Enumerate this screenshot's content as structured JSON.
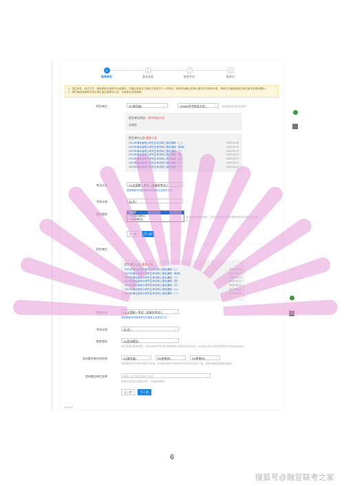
{
  "steps": [
    "报考单位",
    "基本信息",
    "报考专业",
    "报考点"
  ],
  "notice": {
    "line1": "1、招生单位、考试方式、报考类别与报考专业链接处，须通过查阅且了解后才能进行下一步报名，网报时间截止前请以报名时可修改为准，请考生仔细阅读招生单位和专业具体要求。",
    "line2": "2、请仔细阅读报考的招生单位招生简章及公告，以免报名信息错误。"
  },
  "form1": {
    "unit_label": "招生单位",
    "unit_province": "42(湖北省)",
    "unit_school": "10486(华中科技大学)",
    "unit_hint": "请查看该单位招生简章",
    "info_unit_label": "招生单位网站",
    "info_unit_link": "华中科技大学",
    "info_unit_addr": "无地址",
    "notice_title": "招生单位公告",
    "notice_more": "更多公告",
    "links": [
      {
        "text": "2021年湖北省硕士研究生考试网上报名通知（二）",
        "date": "2020.09.18"
      },
      {
        "text": "2021年湖北省硕士研究生考试网上报名通知（新增）",
        "date": "2020.09.17"
      },
      {
        "text": "2021年湖北省硕士研究生考试网上报名通知（三）",
        "date": "2020.09.17"
      },
      {
        "text": "2021年湖北省硕士研究生考试网上报名通知（四）",
        "date": "2020.09.17"
      },
      {
        "text": "2021年湖北省硕士研究生考试网上报名通知（五）",
        "date": "2020.09.17"
      },
      {
        "text": "2021年湖北省硕士研究生考试网上报名通知（六）",
        "date": "2020.09.17"
      },
      {
        "text": "2021年湖北省硕士研究生考试网上报名通知（一）",
        "date": "2020.09.17"
      }
    ],
    "exam_label": "考试方式",
    "exam_value": "21(全国统一考试（含联合考试）)",
    "exam_hint": "请准确填写所报考单位的报考点及报名方式",
    "plan_label": "专项计划",
    "plan_value": "无(无)",
    "cat_label": "报考类别",
    "cat_hint": "请认真核实报考类别，非定向就业考生须在报考类别中选择非定向就业。",
    "dropdown": [
      "请选择",
      "11(非定向就业)",
      "12(定向就业)"
    ],
    "prev": "上一步",
    "next": "下一步"
  },
  "form2": {
    "unit_label": "招生单位",
    "notice_title": "招生单位公告",
    "notice_more": "更多公告",
    "links": [
      {
        "text": "2021年湖北省硕士研究生考试网上报名通知（二）",
        "date": "2020.09.18"
      },
      {
        "text": "2021年湖北省硕士研究生考试网上报名通知（新增）",
        "date": "2020.09.17"
      },
      {
        "text": "2021年湖北省硕士研究生考试网上报名通知（三）",
        "date": "2020.09.17"
      },
      {
        "text": "2021年湖北省硕士研究生考试网上报名通知（四）",
        "date": "2020.09.17"
      },
      {
        "text": "2021年湖北省硕士研究生考试网上报名通知（五）",
        "date": "2020.09.17"
      },
      {
        "text": "2021年湖北省硕士研究生考试网上报名通知（六）",
        "date": "2020.09.17"
      },
      {
        "text": "2021年湖北省硕士研究生考试网上报名通知（一）",
        "date": "2020.09.17"
      }
    ],
    "exam_label": "考试方式",
    "exam_value": "21(全国统一考试（含联合考试）)",
    "exam_hint": "请准确填写所报考单位的报考点及报名方式",
    "plan_label": "专项计划",
    "plan_value": "无(无)",
    "cat_label": "报考类别",
    "cat_value": "11(定向就业)",
    "cat_hint": "请认真核实报考类别，非定向就业考生须在报考类别中选择非定向就业；定向就业考生须在报考类别中选择定向就业。",
    "dir_label": "定向就业单位所在地",
    "dir_province": "42(湖北省)",
    "dir_city": "09(孝感市)",
    "dir_county": "09(孝感市)",
    "dir_hint": "请准确填写定向就业单位所在地，定向就业单位所在地须与定向就业协议一致，否则可能影响录取及报到。",
    "dir_name_label": "定向就业单位名称",
    "dir_name_placeholder": "请输入定向就业单位名称",
    "dir_name_hint": "请填写定向就业单位全称，不能使用简称。",
    "prev": "上一步",
    "next": "下一步"
  },
  "side": {
    "chat": "在线\n客服",
    "qr": "微信\n公众号"
  },
  "footer_note": "©2020",
  "page_number": "6",
  "watermark": "搜狐号@融昱联考之家",
  "colors": {
    "ray": "#e59ad8",
    "primary": "#1e88e5",
    "notice_bg": "#fdf6dd"
  }
}
